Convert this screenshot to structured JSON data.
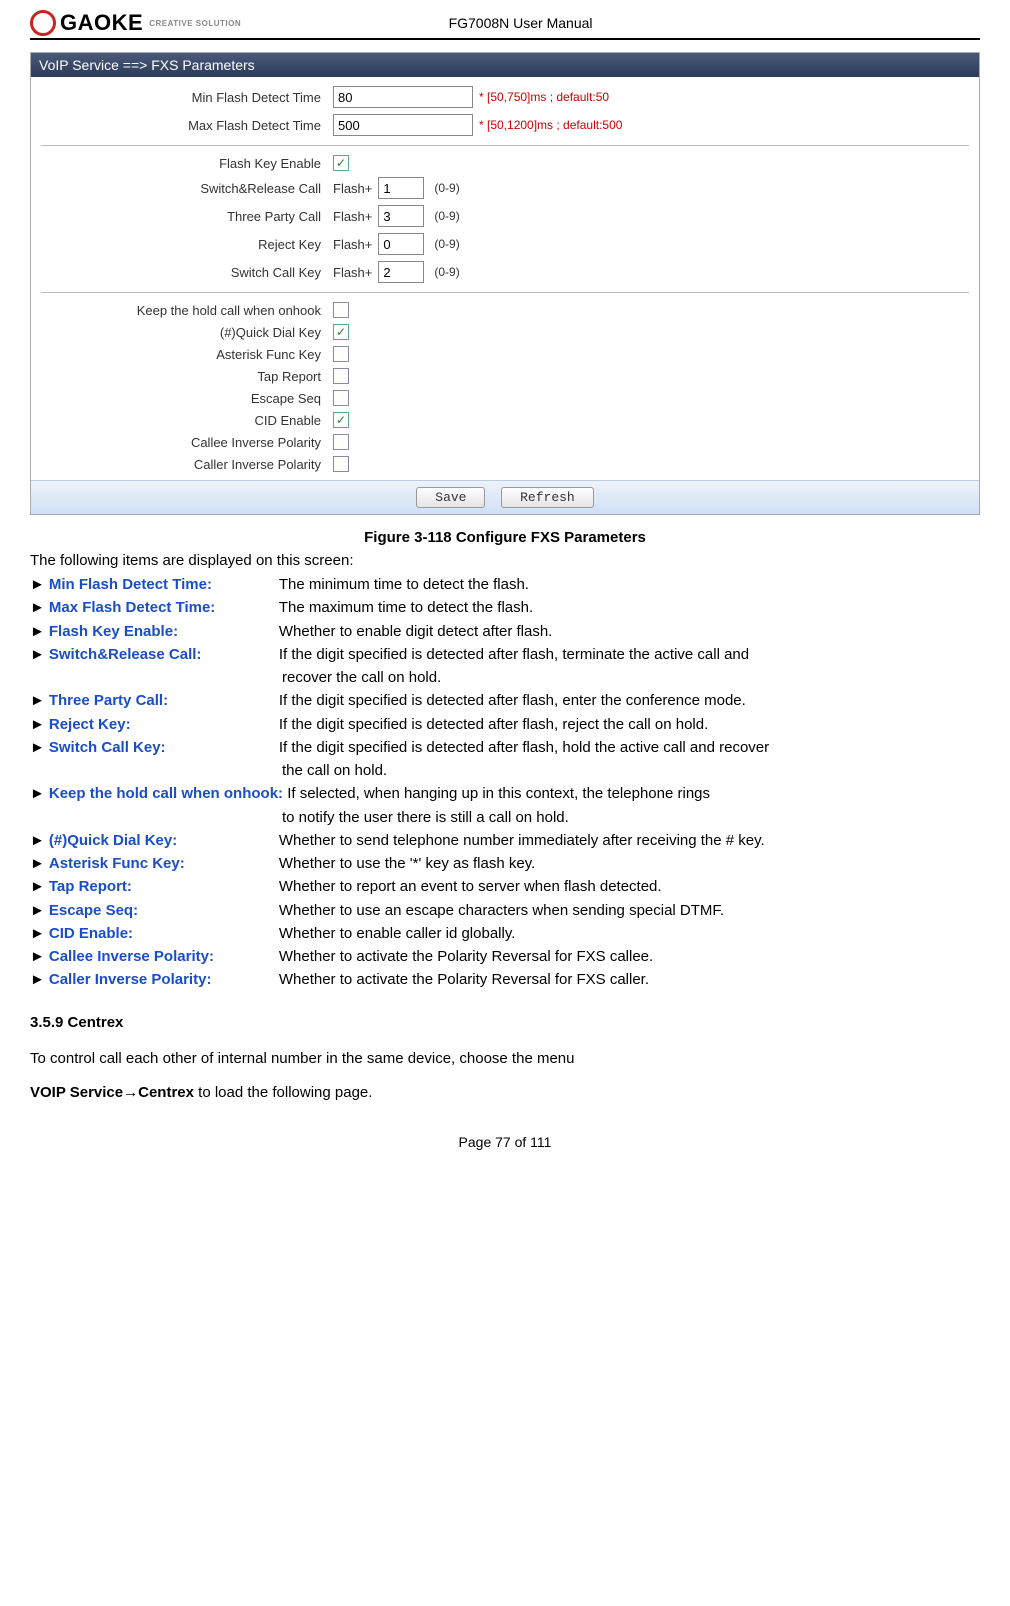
{
  "header": {
    "logo_text": "GAOKE",
    "logo_sub": "CREATIVE SOLUTION",
    "doc_title": "FG7008N User Manual"
  },
  "panel": {
    "title": "VoIP Service ==> FXS Parameters",
    "min_flash_label": "Min Flash Detect Time",
    "min_flash_value": "80",
    "min_flash_hint": "* [50,750]ms ; default:50",
    "max_flash_label": "Max Flash Detect Time",
    "max_flash_value": "500",
    "max_flash_hint": "* [50,1200]ms ; default:500",
    "flash_key_enable_label": "Flash Key Enable",
    "flash_key_enable_checked": true,
    "switch_release_label": "Switch&Release Call",
    "switch_release_value": "1",
    "three_party_label": "Three Party Call",
    "three_party_value": "3",
    "reject_key_label": "Reject Key",
    "reject_key_value": "0",
    "switch_call_key_label": "Switch Call Key",
    "switch_call_key_value": "2",
    "flash_prefix": "Flash+",
    "range_note": "(0-9)",
    "keep_hold_label": "Keep the hold call when onhook",
    "keep_hold_checked": false,
    "quick_dial_label": "(#)Quick Dial Key",
    "quick_dial_checked": true,
    "asterisk_label": "Asterisk Func Key",
    "asterisk_checked": false,
    "tap_report_label": "Tap Report",
    "tap_report_checked": false,
    "escape_label": "Escape Seq",
    "escape_checked": false,
    "cid_label": "CID Enable",
    "cid_checked": true,
    "callee_pol_label": "Callee Inverse Polarity",
    "callee_pol_checked": false,
    "caller_pol_label": "Caller Inverse Polarity",
    "caller_pol_checked": false,
    "save_btn": "Save",
    "refresh_btn": "Refresh"
  },
  "caption": "Figure 3-118 Configure FXS Parameters",
  "intro": "The following items are displayed on this screen:",
  "items": {
    "min_flash_t": "Min Flash Detect Time:",
    "min_flash_d": "The minimum time to detect the flash.",
    "max_flash_t": "Max Flash Detect Time:",
    "max_flash_d": "The maximum time to detect the flash.",
    "flash_key_t": "Flash Key Enable:",
    "flash_key_d": "Whether to enable digit detect after flash.",
    "switch_rel_t": "Switch&Release Call:",
    "switch_rel_d": "If the digit specified is detected after flash, terminate the active call and",
    "switch_rel_d2": "recover the call on hold.",
    "three_t": "Three Party Call:",
    "three_d": "If the digit specified is detected after flash, enter the conference mode.",
    "reject_t": "Reject Key:",
    "reject_d": "If the digit specified is detected after flash, reject the call on hold.",
    "switch_key_t": "Switch Call Key:",
    "switch_key_d": "If the digit specified is detected after flash, hold the active call and recover",
    "switch_key_d2": "the call on hold.",
    "keep_t": "Keep the hold call when onhook:",
    "keep_d": " If selected, when hanging up in this context, the telephone rings",
    "keep_d2": "to notify the user there is still a call on hold.",
    "quick_t": "(#)Quick Dial Key:",
    "quick_d": "Whether to send telephone number immediately after receiving the # key.",
    "ast_t": "Asterisk Func Key:",
    "ast_d": "Whether to use the '*' key as flash key.",
    "tap_t": "Tap Report:",
    "tap_d": "Whether to report an event to server when flash detected.",
    "esc_t": "Escape Seq:",
    "esc_d": "Whether to use an escape characters when sending special DTMF.",
    "cid_t": "CID Enable:",
    "cid_d": "Whether to enable caller id globally.",
    "callee_t": "Callee Inverse Polarity:",
    "callee_d": "Whether to activate the Polarity Reversal for FXS callee.",
    "caller_t": "Caller Inverse Polarity:",
    "caller_d": "Whether to activate the Polarity Reversal for FXS caller."
  },
  "section": {
    "heading": "3.5.9    Centrex",
    "p1": "To control call each other of internal number in the same device, choose the menu",
    "p2a": "VOIP Service→Centrex",
    "p2b": " to load the following page."
  },
  "footer": "Page 77 of 111"
}
